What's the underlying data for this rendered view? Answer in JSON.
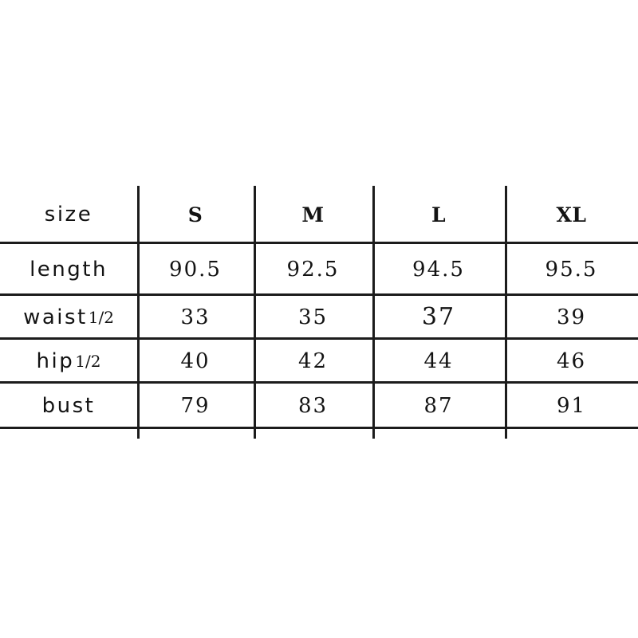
{
  "page": {
    "background_color": "#ffffff",
    "line_color": "#1c1c1c",
    "text_color": "#131313"
  },
  "size_chart": {
    "header_label": "size",
    "columns": [
      "S",
      "M",
      "L",
      "XL"
    ],
    "rows": [
      {
        "label": "length",
        "label_suffix": "",
        "values": [
          "90.5",
          "92.5",
          "94.5",
          "95.5"
        ]
      },
      {
        "label": "waist",
        "label_suffix": "1/2",
        "values": [
          "33",
          "35",
          "37",
          "39"
        ],
        "highlighted_index": 2
      },
      {
        "label": "hip",
        "label_suffix": "1/2",
        "values": [
          "40",
          "42",
          "44",
          "46"
        ]
      },
      {
        "label": "bust",
        "label_suffix": "",
        "values": [
          "79",
          "83",
          "87",
          "91"
        ]
      }
    ]
  }
}
